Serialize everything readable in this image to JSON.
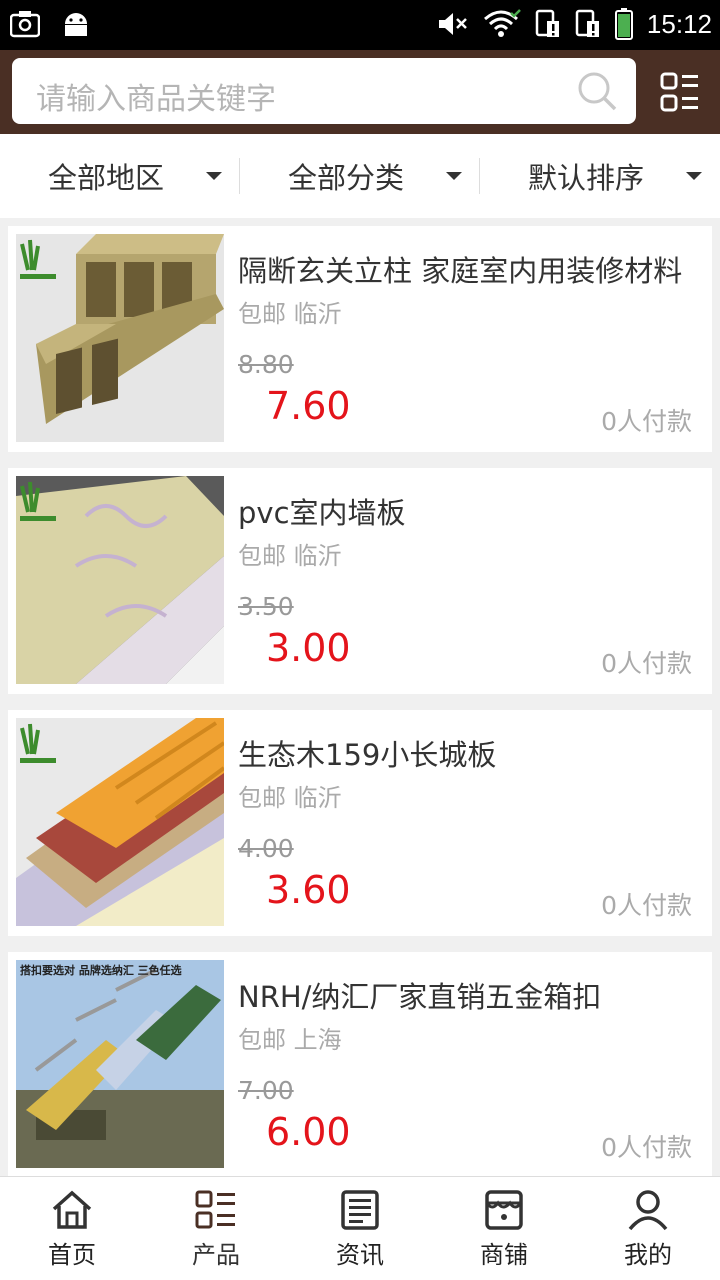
{
  "status_bar": {
    "time": "15:12"
  },
  "search": {
    "placeholder": "请输入商品关键字"
  },
  "filters": [
    {
      "label": "全部地区"
    },
    {
      "label": "全部分类"
    },
    {
      "label": "默认排序"
    }
  ],
  "products": [
    {
      "title": "隔断玄关立柱 家庭室内用装修材料",
      "meta": "包邮 临沂",
      "old_price": "8.80",
      "price": "7.60",
      "sales": "0人付款"
    },
    {
      "title": "pvc室内墙板",
      "meta": "包邮 临沂",
      "old_price": "3.50",
      "price": "3.00",
      "sales": "0人付款"
    },
    {
      "title": "生态木159小长城板",
      "meta": "包邮 临沂",
      "old_price": "4.00",
      "price": "3.60",
      "sales": "0人付款"
    },
    {
      "title": "NRH/纳汇厂家直销五金箱扣",
      "meta": "包邮 上海",
      "old_price": "7.00",
      "price": "6.00",
      "sales": "0人付款",
      "image_text": "搭扣要选对 品牌选纳汇 三色任选"
    }
  ],
  "nav": [
    {
      "label": "首页",
      "icon": "home-icon"
    },
    {
      "label": "产品",
      "icon": "grid-list-icon"
    },
    {
      "label": "资讯",
      "icon": "news-icon"
    },
    {
      "label": "商铺",
      "icon": "shop-icon"
    },
    {
      "label": "我的",
      "icon": "user-icon"
    }
  ],
  "colors": {
    "header_bg": "#4a2f24",
    "price_red": "#e4141b"
  }
}
